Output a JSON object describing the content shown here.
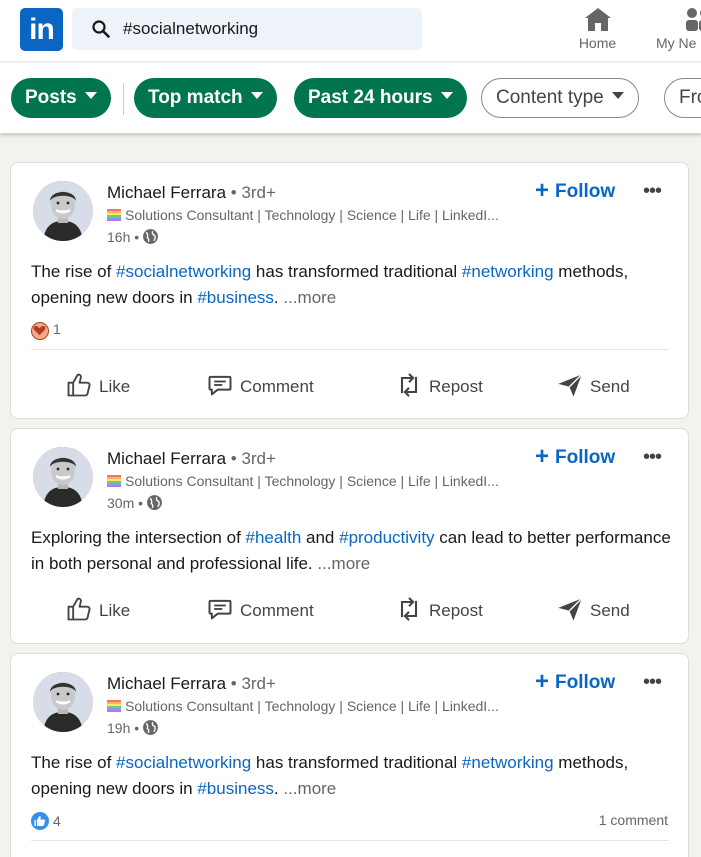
{
  "header": {
    "logo": "in",
    "search_value": "#socialnetworking",
    "nav": [
      {
        "label": "Home",
        "icon": "home-icon"
      },
      {
        "label": "My Ne",
        "icon": "my-network-icon"
      }
    ]
  },
  "filters": [
    {
      "label": "Posts",
      "active": true
    },
    {
      "label": "Top match",
      "active": true
    },
    {
      "label": "Past 24 hours",
      "active": true
    },
    {
      "label": "Content type",
      "active": false
    },
    {
      "label": "Fro",
      "active": false
    }
  ],
  "colors": {
    "brand": "#0a66c2",
    "filter_active": "#01754f",
    "hashtag": "#0a66c2"
  },
  "posts": [
    {
      "author": "Michael Ferrara",
      "degree": " • 3rd+",
      "headline": "Solutions Consultant | Technology | Science | Life | LinkedI...",
      "time": "16h •",
      "follow": "Follow",
      "text_parts": [
        "The rise of ",
        "#socialnetworking",
        " has transformed traditional ",
        "#networking",
        " methods, opening new doors in ",
        "#business",
        ".  "
      ],
      "more": "...more",
      "reaction_count": "1",
      "reaction_icon": "heart-icon",
      "comments": ""
    },
    {
      "author": "Michael Ferrara",
      "degree": " • 3rd+",
      "headline": "Solutions Consultant | Technology | Science | Life | LinkedI...",
      "time": "30m •",
      "follow": "Follow",
      "text_parts": [
        "Exploring the intersection of ",
        "#health",
        " and ",
        "#productivity",
        " can lead to better performance in both personal and professional life.  "
      ],
      "more": "...more",
      "reaction_count": "",
      "comments": ""
    },
    {
      "author": "Michael Ferrara",
      "degree": " • 3rd+",
      "headline": "Solutions Consultant | Technology | Science | Life | LinkedI...",
      "time": "19h •",
      "follow": "Follow",
      "text_parts": [
        "The rise of ",
        "#socialnetworking",
        " has transformed traditional ",
        "#networking",
        " methods, opening new doors in ",
        "#business",
        ".  "
      ],
      "more": "...more",
      "reaction_count": "4",
      "reaction_icon": "like-icon",
      "comments": "1 comment"
    }
  ],
  "actions": {
    "like": "Like",
    "comment": "Comment",
    "repost": "Repost",
    "send": "Send"
  }
}
